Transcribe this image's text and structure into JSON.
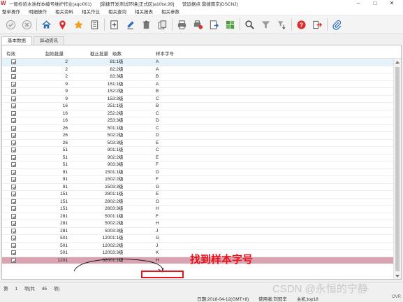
{
  "window": {
    "title_main": "一般检验水准样本编号维护作业(aqci001)",
    "title_env": "[鼎捷开发测试环境(正式区)a10tst,99]",
    "title_org": "营运据点:鼎捷南京(DSCNJ)",
    "controls": [
      "–",
      "□",
      "✕"
    ]
  },
  "menu": [
    "整单操作",
    "明细操作",
    "相关资料",
    "相关作业",
    "相关查询",
    "相关报表",
    "相关参数"
  ],
  "toolbar": [
    {
      "name": "confirm-icon"
    },
    {
      "name": "cancel-icon"
    },
    {
      "name": "home-icon"
    },
    {
      "name": "location-pin-icon"
    },
    {
      "name": "favorite-star-icon"
    },
    {
      "name": "document-list-icon"
    },
    {
      "name": "add-icon"
    },
    {
      "name": "edit-icon"
    },
    {
      "name": "delete-icon"
    },
    {
      "name": "copy-icon"
    },
    {
      "name": "print-icon"
    },
    {
      "name": "print-setup-icon"
    },
    {
      "name": "export-icon"
    },
    {
      "name": "grid-icon"
    },
    {
      "name": "search-icon"
    },
    {
      "name": "filter-icon"
    },
    {
      "name": "sort-icon"
    },
    {
      "name": "help-icon"
    },
    {
      "name": "exit-icon"
    },
    {
      "name": "attachment-icon"
    }
  ],
  "tabs": [
    "基本数据",
    "异动资讯"
  ],
  "columns": {
    "valid": "有效",
    "start": "起始批量",
    "end": "截止批量",
    "level": "级数",
    "code": "样本字号"
  },
  "rows": [
    {
      "start": "2",
      "end": "8",
      "level": "1:1级",
      "code": "A"
    },
    {
      "start": "2",
      "end": "8",
      "level": "2:2级",
      "code": "A"
    },
    {
      "start": "2",
      "end": "8",
      "level": "3:3级",
      "code": "B"
    },
    {
      "start": "9",
      "end": "15",
      "level": "1:1级",
      "code": "A"
    },
    {
      "start": "9",
      "end": "15",
      "level": "2:2级",
      "code": "B"
    },
    {
      "start": "9",
      "end": "15",
      "level": "3:3级",
      "code": "C"
    },
    {
      "start": "16",
      "end": "25",
      "level": "1:1级",
      "code": "B"
    },
    {
      "start": "16",
      "end": "25",
      "level": "2:2级",
      "code": "C"
    },
    {
      "start": "16",
      "end": "25",
      "level": "3:3级",
      "code": "D"
    },
    {
      "start": "26",
      "end": "50",
      "level": "1:1级",
      "code": "C"
    },
    {
      "start": "26",
      "end": "50",
      "level": "2:2级",
      "code": "D"
    },
    {
      "start": "26",
      "end": "50",
      "level": "3:3级",
      "code": "E"
    },
    {
      "start": "51",
      "end": "90",
      "level": "1:1级",
      "code": "C"
    },
    {
      "start": "51",
      "end": "90",
      "level": "2:2级",
      "code": "E"
    },
    {
      "start": "51",
      "end": "90",
      "level": "3:3级",
      "code": "F"
    },
    {
      "start": "91",
      "end": "150",
      "level": "1:1级",
      "code": "D"
    },
    {
      "start": "91",
      "end": "150",
      "level": "2:2级",
      "code": "F"
    },
    {
      "start": "91",
      "end": "150",
      "level": "3:3级",
      "code": "G"
    },
    {
      "start": "151",
      "end": "280",
      "level": "1:1级",
      "code": "E"
    },
    {
      "start": "151",
      "end": "280",
      "level": "2:2级",
      "code": "G"
    },
    {
      "start": "151",
      "end": "280",
      "level": "3:3级",
      "code": "H"
    },
    {
      "start": "281",
      "end": "500",
      "level": "1:1级",
      "code": "F"
    },
    {
      "start": "281",
      "end": "500",
      "level": "2:2级",
      "code": "H"
    },
    {
      "start": "281",
      "end": "500",
      "level": "3:3级",
      "code": "J"
    },
    {
      "start": "501",
      "end": "1200",
      "level": "1:1级",
      "code": "G"
    },
    {
      "start": "501",
      "end": "1200",
      "level": "2:2级",
      "code": "J"
    },
    {
      "start": "501",
      "end": "1200",
      "level": "3:3级",
      "code": "K"
    },
    {
      "start": "1201",
      "end": "3200",
      "level": "1:1级",
      "code": "H"
    }
  ],
  "selected_row": 0,
  "highlight_row": 27,
  "annotation": "找到样本字号",
  "status": {
    "label": "第",
    "current": "1",
    "total_label": "项(共",
    "total": "45",
    "unit": "项)"
  },
  "bottom": {
    "date": "日期:2018-04-12(GMT+8)",
    "user": "使用者:刘冠辛",
    "host": "主机:top18",
    "ovr": "OVR"
  },
  "watermark": "CSDN @永恒的宁静",
  "colors": {
    "highlight": "#d9a3b1",
    "selected": "#e4f3fa",
    "annotation": "#e8121b"
  }
}
